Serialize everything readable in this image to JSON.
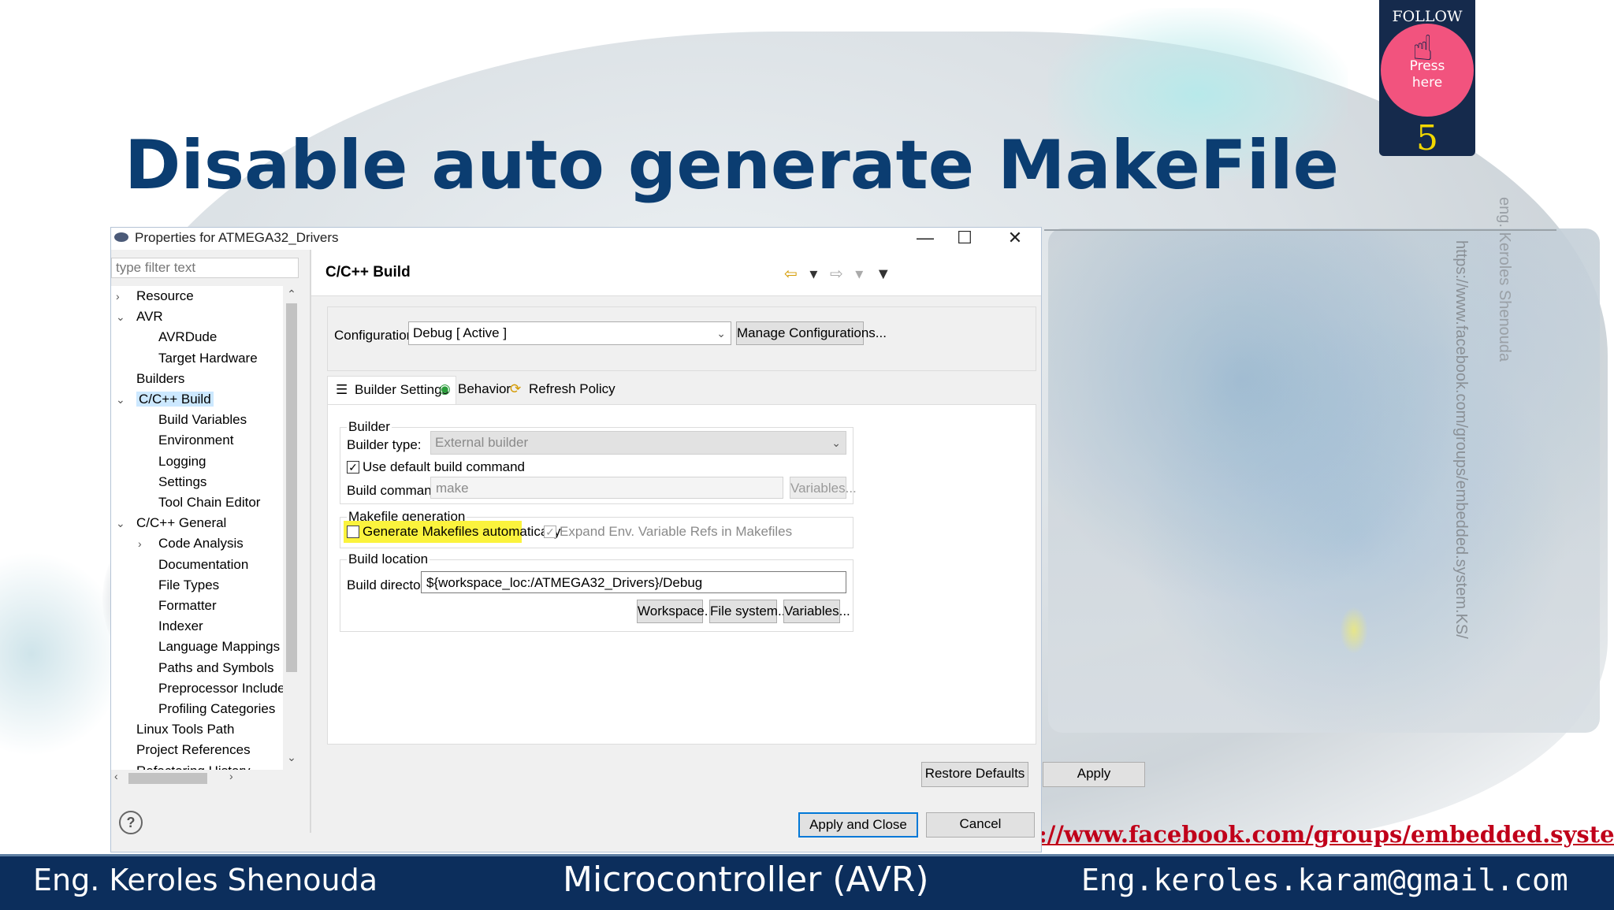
{
  "slide": {
    "title": "Disable auto generate MakeFile",
    "watermark_name": "eng. Keroles Shenouda",
    "watermark_url": "https://www.facebook.com/groups/embedded.system.KS/",
    "follow_us": "FOLLOW US",
    "press": "Press",
    "here": "here",
    "slide_number": "5",
    "fb_link": "://www.facebook.com/groups/embedded.system.KS/",
    "footer_author": "Eng. Keroles Shenouda",
    "footer_course": "Microcontroller (AVR)",
    "footer_email": "Eng.keroles.karam@gmail.com",
    "title_color": "#0b3d71",
    "footer_color": "#0c2e5c"
  },
  "dialog": {
    "title": "Properties for ATMEGA32_Drivers",
    "filter_placeholder": "type filter text",
    "tree": [
      {
        "label": "Resource",
        "indent": 0,
        "arrow": ">"
      },
      {
        "label": "AVR",
        "indent": 0,
        "arrow": "v"
      },
      {
        "label": "AVRDude",
        "indent": 1,
        "arrow": ""
      },
      {
        "label": "Target Hardware",
        "indent": 1,
        "arrow": ""
      },
      {
        "label": "Builders",
        "indent": 0,
        "arrow": ""
      },
      {
        "label": "C/C++ Build",
        "indent": 0,
        "arrow": "v",
        "selected": true
      },
      {
        "label": "Build Variables",
        "indent": 1,
        "arrow": ""
      },
      {
        "label": "Environment",
        "indent": 1,
        "arrow": ""
      },
      {
        "label": "Logging",
        "indent": 1,
        "arrow": ""
      },
      {
        "label": "Settings",
        "indent": 1,
        "arrow": ""
      },
      {
        "label": "Tool Chain Editor",
        "indent": 1,
        "arrow": ""
      },
      {
        "label": "C/C++ General",
        "indent": 0,
        "arrow": "v"
      },
      {
        "label": "Code Analysis",
        "indent": 1,
        "arrow": ">"
      },
      {
        "label": "Documentation",
        "indent": 1,
        "arrow": ""
      },
      {
        "label": "File Types",
        "indent": 1,
        "arrow": ""
      },
      {
        "label": "Formatter",
        "indent": 1,
        "arrow": ""
      },
      {
        "label": "Indexer",
        "indent": 1,
        "arrow": ""
      },
      {
        "label": "Language Mappings",
        "indent": 1,
        "arrow": ""
      },
      {
        "label": "Paths and Symbols",
        "indent": 1,
        "arrow": ""
      },
      {
        "label": "Preprocessor Include",
        "indent": 1,
        "arrow": ""
      },
      {
        "label": "Profiling Categories",
        "indent": 1,
        "arrow": ""
      },
      {
        "label": "Linux Tools Path",
        "indent": 0,
        "arrow": ""
      },
      {
        "label": "Project References",
        "indent": 0,
        "arrow": ""
      },
      {
        "label": "Refactoring History",
        "indent": 0,
        "arrow": ""
      }
    ],
    "page_title": "C/C++ Build",
    "configuration_label": "Configuration:",
    "configuration_value": "Debug  [ Active ]",
    "manage_configurations": "Manage Configurations...",
    "tabs": [
      {
        "label": "Builder Settings",
        "icon": "list-icon"
      },
      {
        "label": "Behavior",
        "icon": "radio-icon"
      },
      {
        "label": "Refresh Policy",
        "icon": "refresh-icon"
      }
    ],
    "builder_group": "Builder",
    "builder_type_label": "Builder type:",
    "builder_type_value": "External builder",
    "use_default_label": "Use default build command",
    "use_default_checked": true,
    "build_command_label": "Build command:",
    "build_command_value": "make",
    "variables_btn": "Variables...",
    "makefile_group": "Makefile generation",
    "generate_label": "Generate Makefiles automatically",
    "generate_checked": false,
    "expand_label": "Expand Env. Variable Refs in Makefiles",
    "expand_checked": true,
    "location_group": "Build location",
    "build_dir_label": "Build directory:",
    "build_dir_value": "${workspace_loc:/ATMEGA32_Drivers}/Debug",
    "workspace_btn": "Workspace...",
    "filesystem_btn": "File system...",
    "variables_btn2": "Variables...",
    "restore_defaults": "Restore Defaults",
    "apply": "Apply",
    "apply_close": "Apply and Close",
    "cancel": "Cancel",
    "help": "?",
    "highlight_color": "#fbf33d",
    "selection_color": "#cce8ff"
  }
}
